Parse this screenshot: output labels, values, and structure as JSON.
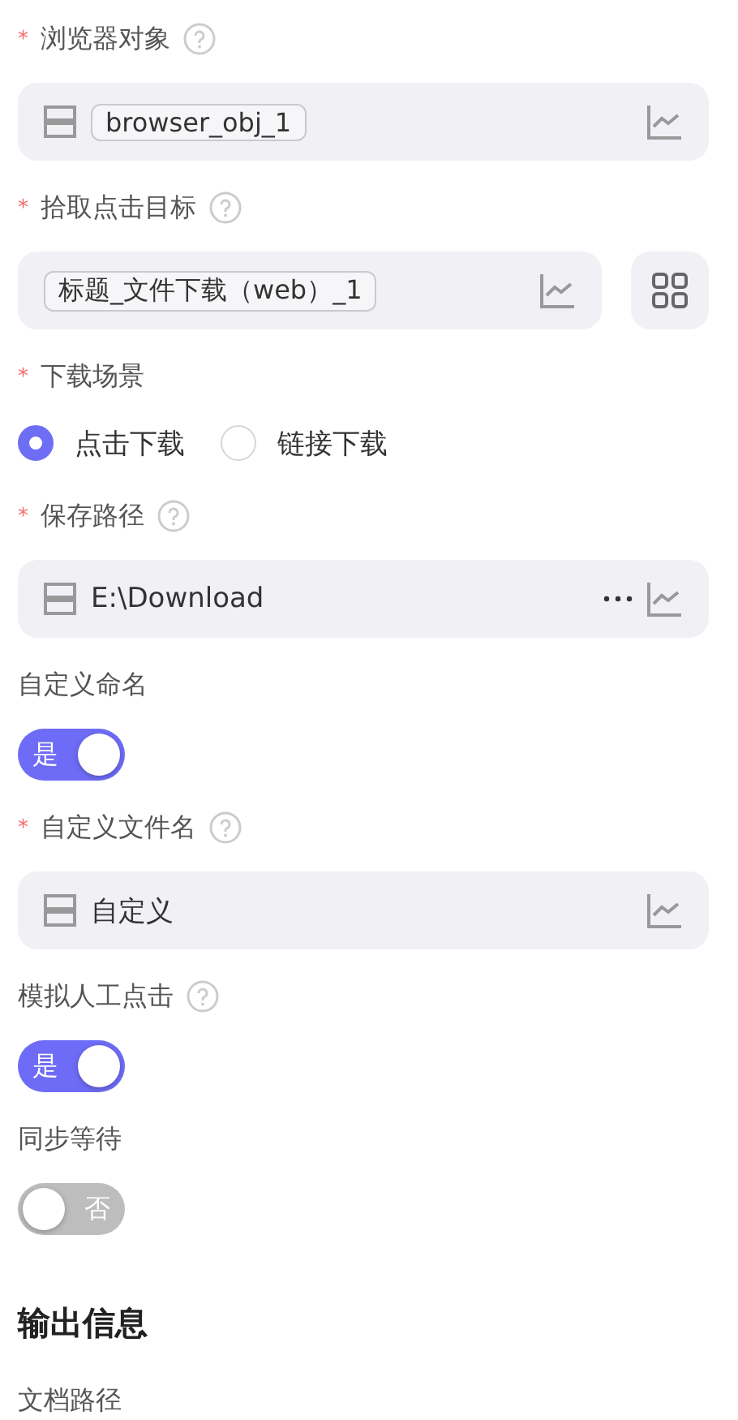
{
  "form": [
    {
      "kind": "field",
      "label": "浏览器对象",
      "required": "*",
      "help": true,
      "value": "browser_obj_1",
      "chip": true,
      "db_icon": true,
      "more": false,
      "side_button": false
    },
    {
      "kind": "field",
      "label": "拾取点击目标",
      "required": "*",
      "help": true,
      "value": "标题_文件下载（web）_1",
      "chip": true,
      "db_icon": false,
      "more": false,
      "side_button": true
    },
    {
      "kind": "radio",
      "label": "下载场景",
      "required": "*",
      "help": false,
      "options": [
        {
          "label": "点击下载",
          "selected": true
        },
        {
          "label": "链接下载",
          "selected": false
        }
      ]
    },
    {
      "kind": "field",
      "label": "保存路径",
      "required": "*",
      "help": true,
      "value": "E:\\Download",
      "chip": false,
      "db_icon": true,
      "more": true,
      "side_button": false
    },
    {
      "kind": "toggle",
      "label": "自定义命名",
      "help": false,
      "on": true,
      "text": "是"
    },
    {
      "kind": "field",
      "label": "自定义文件名",
      "required": "*",
      "help": true,
      "value": "自定义",
      "chip": false,
      "db_icon": true,
      "more": false,
      "side_button": false
    },
    {
      "kind": "toggle",
      "label": "模拟人工点击",
      "help": true,
      "on": true,
      "text": "是"
    },
    {
      "kind": "toggle",
      "label": "同步等待",
      "help": false,
      "on": false,
      "text": "否"
    },
    {
      "kind": "heading",
      "text": "输出信息"
    },
    {
      "kind": "label",
      "label": "文档路径",
      "help": false
    }
  ]
}
